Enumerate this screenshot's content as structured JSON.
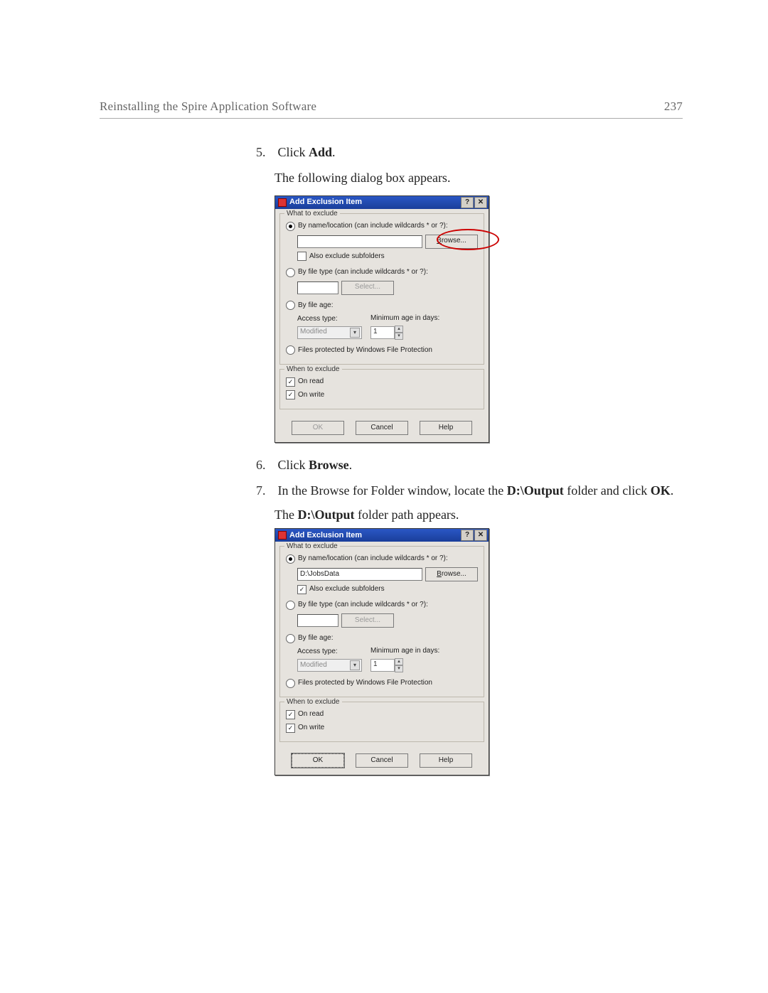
{
  "header": {
    "section_title": "Reinstalling the Spire Application Software",
    "page_number": "237"
  },
  "steps": {
    "s5_num": "5.",
    "s5_text_a": "Click ",
    "s5_text_b": "Add",
    "s5_text_c": ".",
    "s5_follow": "The following dialog box appears.",
    "s6_num": "6.",
    "s6_text_a": "Click ",
    "s6_text_b": "Browse",
    "s6_text_c": ".",
    "s7_num": "7.",
    "s7_text_a": "In the Browse for Folder window, locate the ",
    "s7_text_b": "D:\\Output",
    "s7_text_c": " folder and click ",
    "s7_text_d": "OK",
    "s7_text_e": ".",
    "s7_follow_a": "The ",
    "s7_follow_b": "D:\\Output",
    "s7_follow_c": " folder path appears."
  },
  "dlg": {
    "title": "Add Exclusion Item",
    "grp_what": "What to exclude",
    "opt_by_name": "By name/location (can include wildcards * or ?):",
    "browse_btn": "Browse...",
    "also_sub": "Also exclude subfolders",
    "opt_by_type": "By file type (can include wildcards * or ?):",
    "select_btn": "Select...",
    "opt_by_age": "By file age:",
    "access_type": "Access type:",
    "access_val": "Modified",
    "min_age": "Minimum age in days:",
    "min_age_val": "1",
    "opt_wfp": "Files protected by Windows File Protection",
    "grp_when": "When to exclude",
    "on_read": "On read",
    "on_write": "On write",
    "ok": "OK",
    "cancel": "Cancel",
    "help": "Help",
    "path_value": "D:\\JobsData",
    "help_icon": "?",
    "close_icon": "✕"
  }
}
